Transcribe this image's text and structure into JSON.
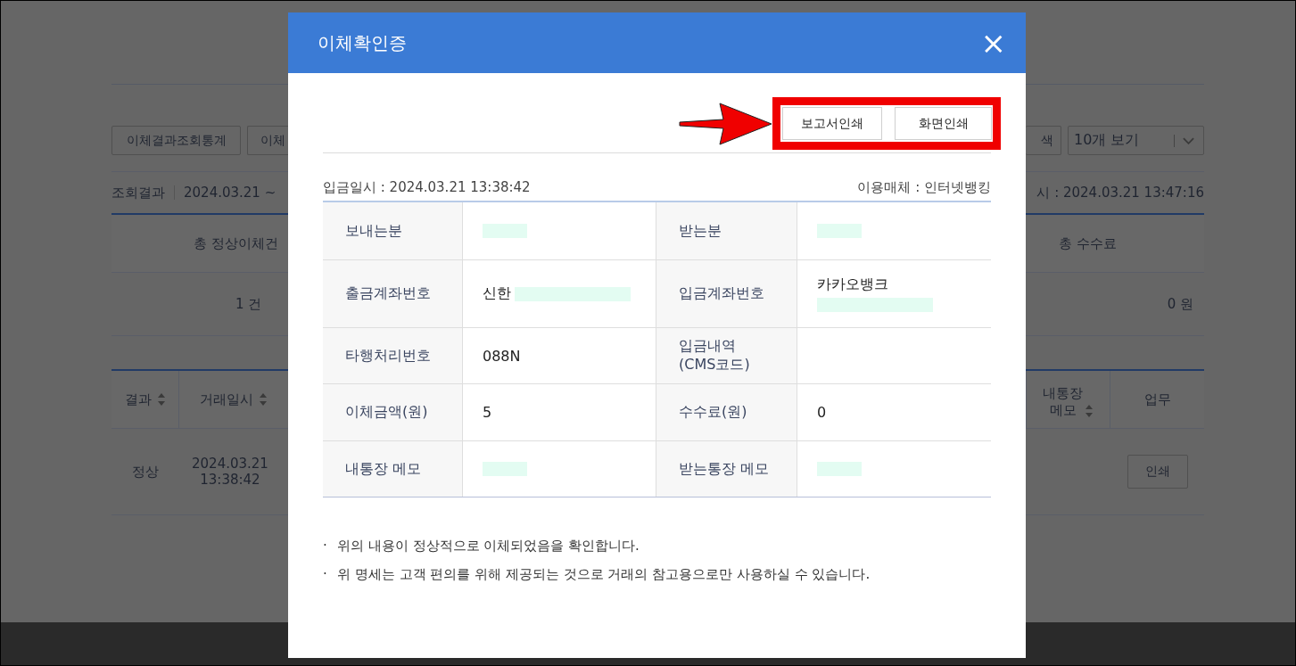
{
  "background": {
    "buttons": [
      {
        "label": "이체결과조회통계"
      },
      {
        "label": "이체"
      }
    ],
    "result_label": "조회결과",
    "date_range": "2024.03.21 ~",
    "summary_headers": [
      "총 정상이체건",
      "총 수수료"
    ],
    "summary_values": [
      "1 건",
      "0 원"
    ],
    "right_button": "색",
    "page_size": "10개 보기",
    "query_time": "시 :  2024.03.21 13:47:16",
    "left_columns": [
      "결과",
      "거래일시"
    ],
    "right_columns": [
      "내통장\n메모",
      "업무"
    ],
    "row": {
      "result": "정상",
      "date": "2024.03.21\n13:38:42",
      "action": "인쇄"
    }
  },
  "dialog": {
    "title": "이체확인증",
    "close": "×",
    "actions": [
      {
        "label": "보고서인쇄"
      },
      {
        "label": "화면인쇄"
      }
    ],
    "deposit_time": "입금일시 : 2024.03.21 13:38:42",
    "channel": "이용매체 : 인터넷뱅킹",
    "rows": [
      [
        {
          "label": "보내는분",
          "value": {
            "masked": true,
            "long": false
          }
        },
        {
          "label": "받는분",
          "value": {
            "masked": true,
            "long": false
          }
        }
      ],
      [
        {
          "label": "출금계좌번호",
          "value": {
            "text": "신한",
            "masked": true,
            "long": true
          }
        },
        {
          "label": "입금계좌번호",
          "value": {
            "text": "카카오뱅크",
            "masked": true,
            "long": true
          }
        }
      ],
      [
        {
          "label": "타행처리번호",
          "value": {
            "text": "088N"
          }
        },
        {
          "label": "입금내역\n(CMS코드)"
        }
      ],
      [
        {
          "label": "이체금액(원)",
          "value": {
            "text": "5"
          }
        },
        {
          "label": "수수료(원)",
          "value": {
            "text": "0"
          }
        }
      ],
      [
        {
          "label": "내통장 메모",
          "value": {
            "masked": true,
            "long": false
          }
        },
        {
          "label": "받는통장 메모",
          "value": {
            "masked": true,
            "long": false
          }
        }
      ]
    ],
    "notes": [
      {
        "mark": "·",
        "text": "위의 내용이 정상적으로 이체되었음을 확인합니다."
      },
      {
        "mark": "·",
        "text": "위 명세는 고객 편의를 위해 제공되는 것으로 거래의 참고용으로만 사용하실 수 있습니다."
      }
    ]
  }
}
